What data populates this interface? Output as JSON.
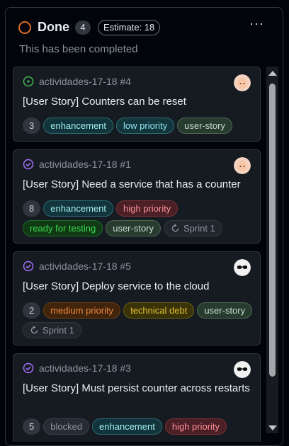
{
  "column": {
    "title": "Done",
    "count": "4",
    "estimate": "Estimate: 18",
    "more": "···",
    "description": "This has been completed"
  },
  "cards": [
    {
      "meta": "actividades-17-18 #4",
      "status": "open",
      "title": "[User Story] Counters can be reset",
      "tags": [
        "3",
        "enhancement",
        "low priority",
        "user-story"
      ]
    },
    {
      "meta": "actividades-17-18 #1",
      "status": "closed",
      "title": "[User Story] Need a service that has a counter",
      "tags": [
        "8",
        "enhancement",
        "high priority",
        "ready for testing",
        "user-story",
        "Sprint 1"
      ]
    },
    {
      "meta": "actividades-17-18 #5",
      "status": "closed",
      "title": "[User Story] Deploy service to the cloud",
      "tags": [
        "2",
        "medium priority",
        "technical debt",
        "user-story",
        "Sprint 1"
      ]
    },
    {
      "meta": "actividades-17-18 #3",
      "status": "closed",
      "title": "[User Story] Must persist counter across restarts",
      "tags": [
        "5",
        "blocked",
        "enhancement",
        "high priority"
      ]
    }
  ],
  "colors": {
    "done_status": "#db6d28",
    "open_icon": "#3fb950",
    "closed_icon": "#a371f7"
  },
  "icons": {
    "open": "circle-dot-icon",
    "closed": "check-circle-icon",
    "sprint": "iteration-icon",
    "more": "kebab-horizontal-icon"
  }
}
